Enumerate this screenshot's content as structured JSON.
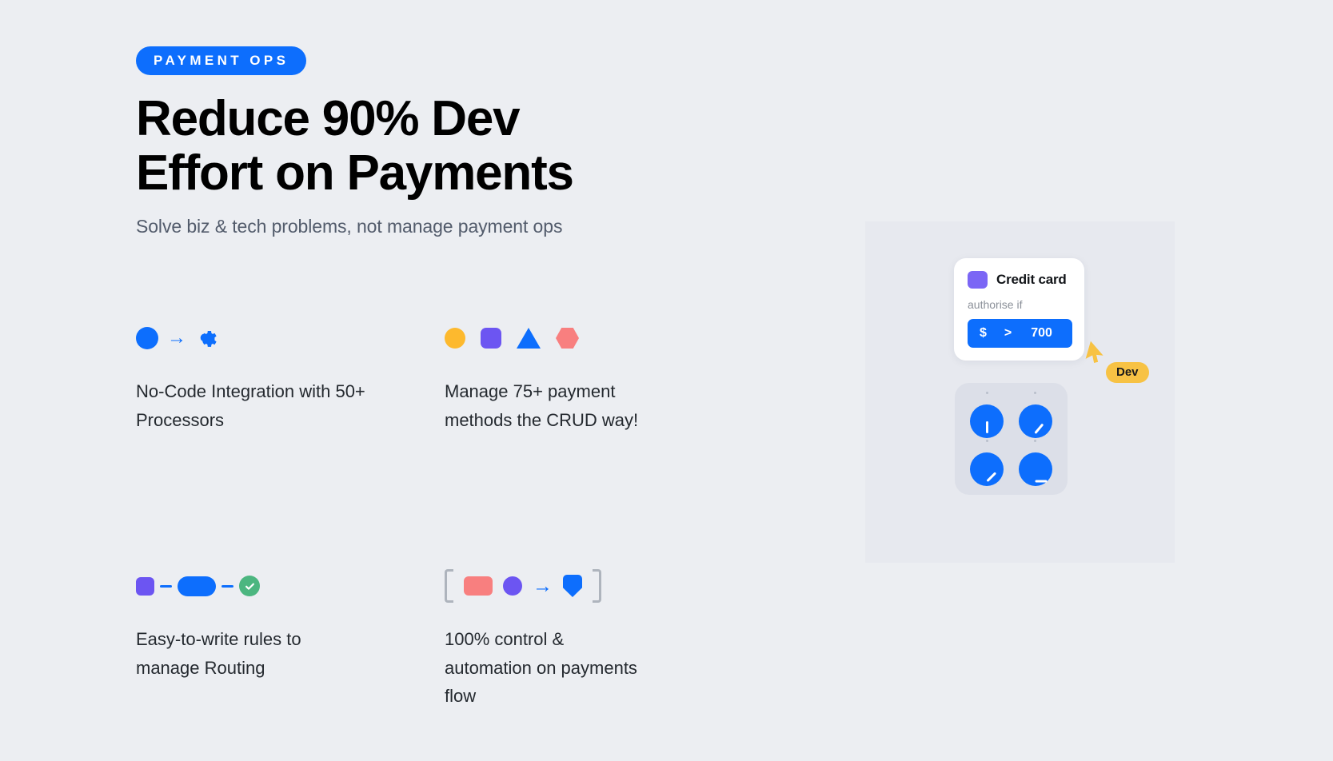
{
  "hero": {
    "eyebrow": "PAYMENT OPS",
    "headline_line1": "Reduce 90% Dev",
    "headline_line2": "Effort on Payments",
    "subhead": "Solve biz & tech problems, not manage payment ops"
  },
  "features": [
    {
      "id": "no-code-integration",
      "text": "No-Code Integration with 50+ Processors",
      "icons": [
        "blue-circle",
        "arrow-right",
        "gear"
      ]
    },
    {
      "id": "payment-methods",
      "text": "Manage 75+ payment methods the CRUD way!",
      "icons": [
        "yellow-circle",
        "purple-square",
        "blue-triangle",
        "salmon-hexagon"
      ]
    },
    {
      "id": "routing-rules",
      "text": "Easy-to-write rules to manage Routing",
      "icons": [
        "purple-square",
        "dash",
        "blue-pill",
        "dash",
        "green-check-circle"
      ]
    },
    {
      "id": "payments-flow-control",
      "text": "100% control & automation on payments flow",
      "icons": [
        "bracket-left",
        "salmon-rect",
        "purple-circle",
        "arrow-right",
        "blue-shield",
        "bracket-right"
      ]
    }
  ],
  "rule_card": {
    "title": "Credit card",
    "subtitle": "authorise if",
    "condition": {
      "currency": "$",
      "operator": ">",
      "value": "700"
    }
  },
  "cursor": {
    "label": "Dev"
  },
  "dials": [
    {
      "name": "dial-1",
      "angle_deg": 0
    },
    {
      "name": "dial-2",
      "angle_deg": 40
    },
    {
      "name": "dial-3",
      "angle_deg": 45
    },
    {
      "name": "dial-4",
      "angle_deg": 90
    }
  ],
  "colors": {
    "background": "#eceef2",
    "accent_blue": "#0d6efd",
    "purple": "#6c55f2",
    "yellow": "#fdb92e",
    "salmon": "#f87f7f",
    "green": "#4cb680",
    "amber": "#f7c244"
  }
}
